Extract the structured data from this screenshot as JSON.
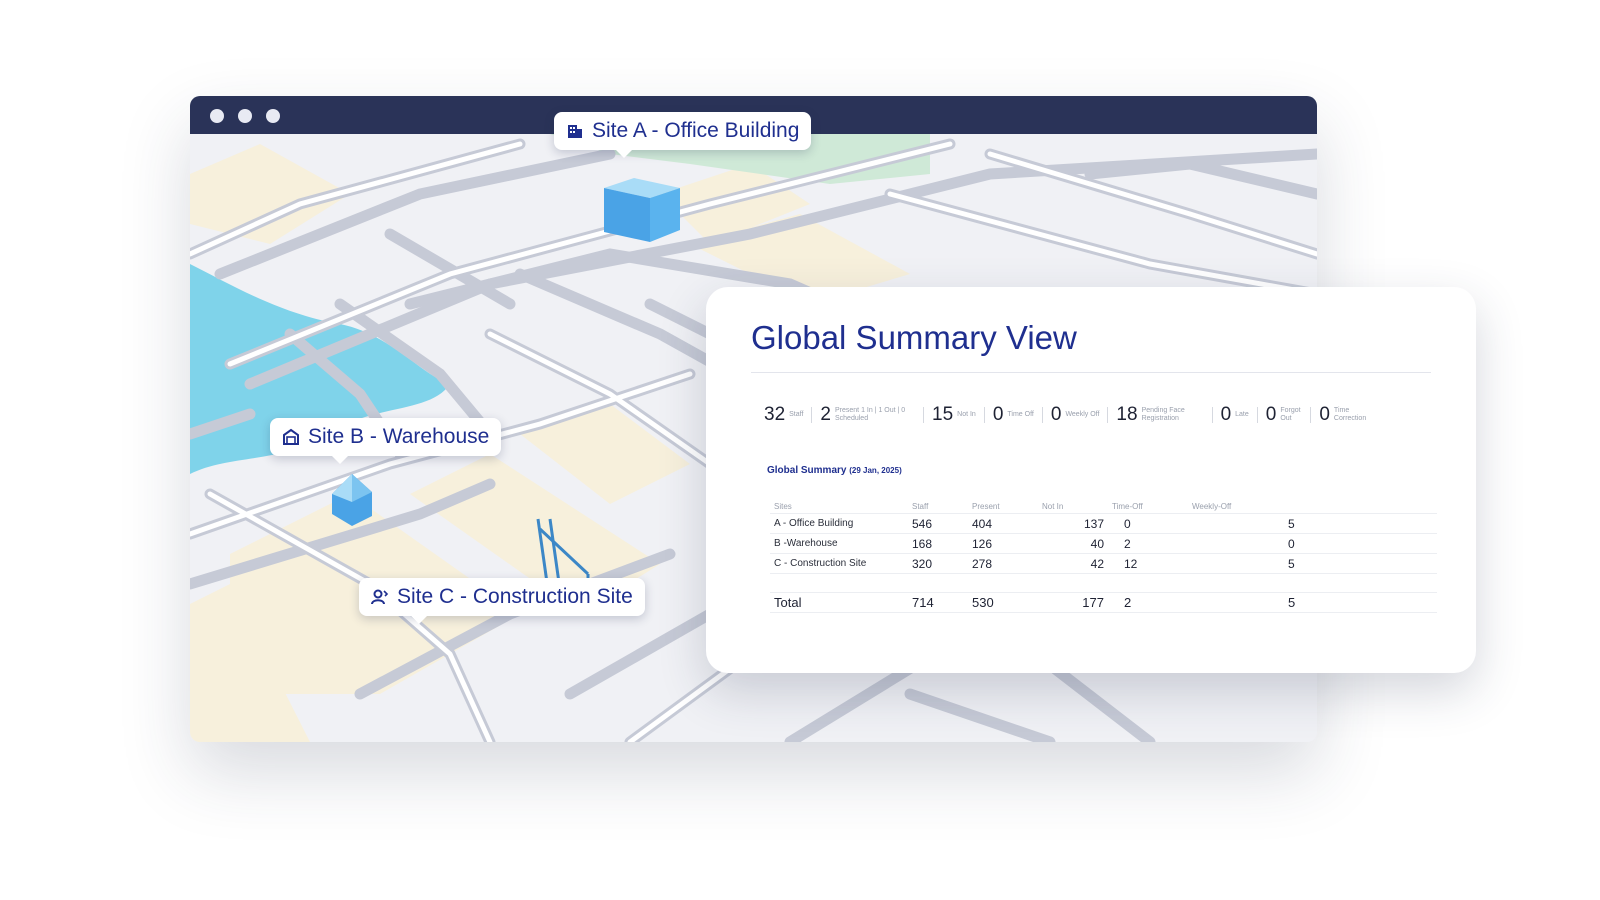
{
  "browser": {
    "window_controls": [
      "dot",
      "dot",
      "dot"
    ]
  },
  "map": {
    "pins": [
      {
        "label": "Site A - Office Building",
        "icon": "building-icon"
      },
      {
        "label": "Site B - Warehouse",
        "icon": "warehouse-icon"
      },
      {
        "label": "Site C - Construction Site",
        "icon": "worker-icon"
      }
    ]
  },
  "summary": {
    "title": "Global Summary View",
    "stats": [
      {
        "value": "32",
        "label": "Staff"
      },
      {
        "value": "2",
        "label": "Present 1 In | 1 Out | 0 Scheduled"
      },
      {
        "value": "15",
        "label": "Not In"
      },
      {
        "value": "0",
        "label": "Time Off"
      },
      {
        "value": "0",
        "label": "Weekly Off"
      },
      {
        "value": "18",
        "label": "Pending Face Registration"
      },
      {
        "value": "0",
        "label": "Late"
      },
      {
        "value": "0",
        "label": "Forgot Out"
      },
      {
        "value": "0",
        "label": "Time Correction"
      }
    ],
    "table_title": "Global Summary",
    "table_date": "(29 Jan, 2025)",
    "columns": [
      "Sites",
      "Staff",
      "Present",
      "Not In",
      "Time-Off",
      "Weekly-Off"
    ],
    "rows": [
      [
        "A - Office Building",
        "546",
        "404",
        "137",
        "0",
        "5"
      ],
      [
        "B -Warehouse",
        "168",
        "126",
        "40",
        "2",
        "0"
      ],
      [
        "C - Construction Site",
        "320",
        "278",
        "42",
        "12",
        "5"
      ]
    ],
    "total": [
      "Total",
      "714",
      "530",
      "177",
      "2",
      "5"
    ]
  },
  "colors": {
    "titlebar": "#2a3358",
    "accent": "#1f2f8f",
    "water": "#7fd3ea",
    "building": "#4aa3e6"
  }
}
